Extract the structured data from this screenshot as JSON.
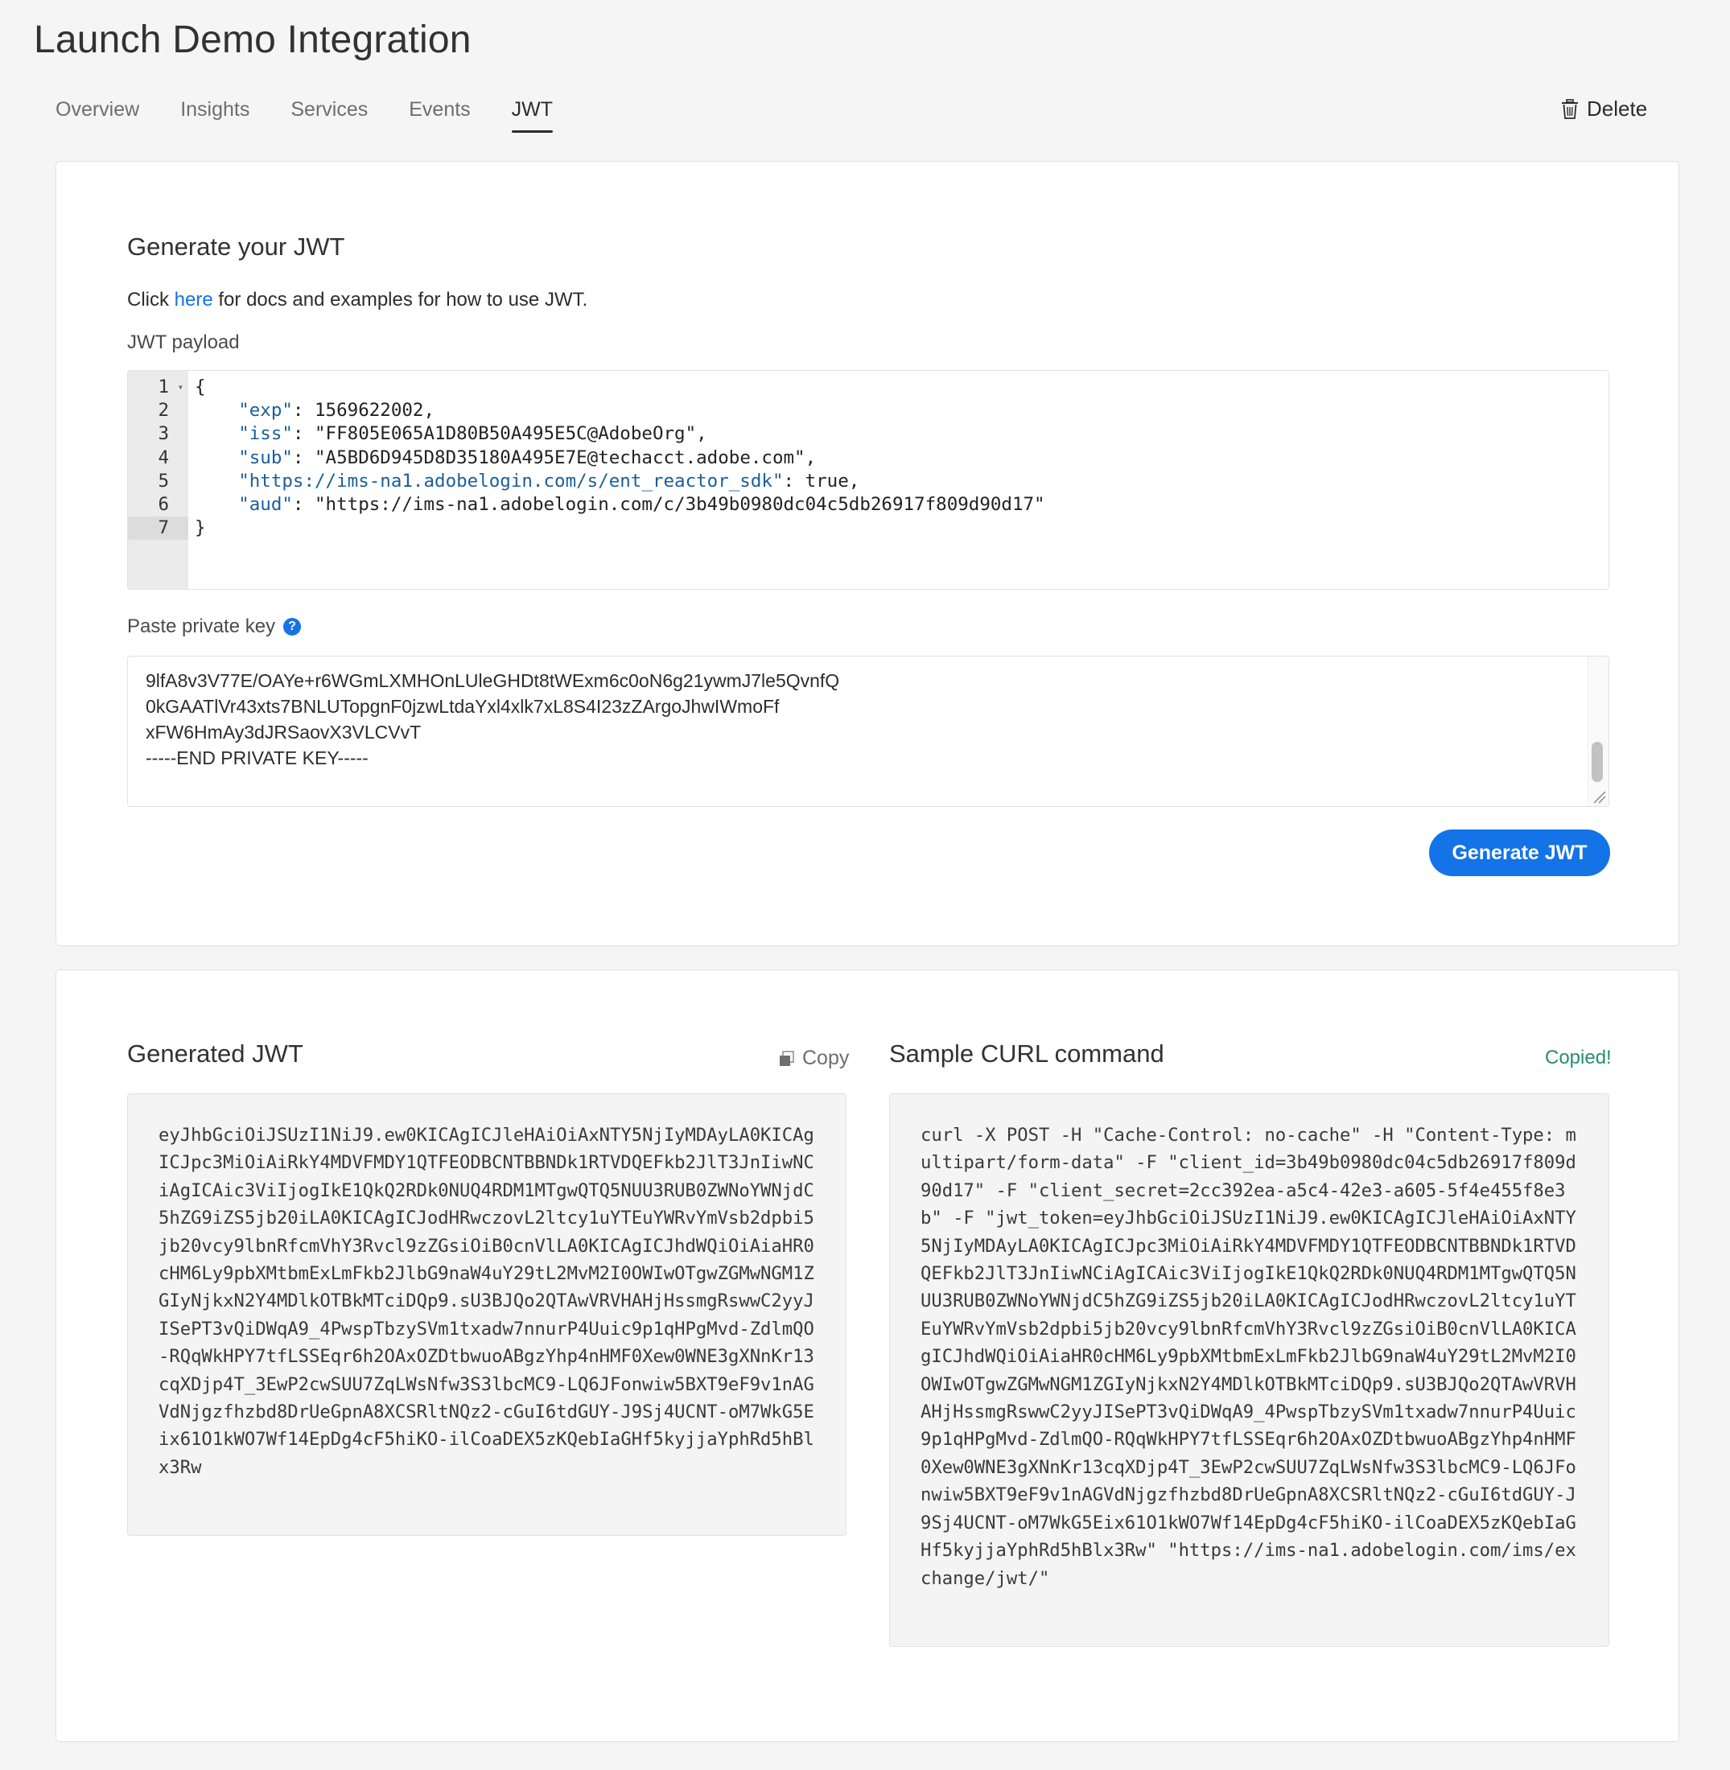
{
  "page": {
    "title": "Launch Demo Integration"
  },
  "tabs": [
    {
      "label": "Overview",
      "active": false
    },
    {
      "label": "Insights",
      "active": false
    },
    {
      "label": "Services",
      "active": false
    },
    {
      "label": "Events",
      "active": false
    },
    {
      "label": "JWT",
      "active": true
    }
  ],
  "header": {
    "delete_label": "Delete",
    "delete_icon": "trash-icon"
  },
  "generate_section": {
    "title": "Generate your JWT",
    "help_prefix": "Click ",
    "help_link": "here",
    "help_suffix": " for docs and examples for how to use JWT.",
    "payload_label": "JWT payload",
    "payload_lines": [
      {
        "num": "1",
        "text": "{"
      },
      {
        "num": "2",
        "text": "    \"exp\": 1569622002,"
      },
      {
        "num": "3",
        "text": "    \"iss\": \"FF805E065A1D80B50A495E5C@AdobeOrg\","
      },
      {
        "num": "4",
        "text": "    \"sub\": \"A5BD6D945D8D35180A495E7E@techacct.adobe.com\","
      },
      {
        "num": "5",
        "text": "    \"https://ims-na1.adobelogin.com/s/ent_reactor_sdk\": true,"
      },
      {
        "num": "6",
        "text": "    \"aud\": \"https://ims-na1.adobelogin.com/c/3b49b0980dc04c5db26917f809d90d17\""
      },
      {
        "num": "7",
        "text": "}"
      }
    ],
    "active_line": "7",
    "private_key_label": "Paste private key",
    "private_key_lines": [
      "9lfA8v3V77E/OAYe+r6WGmLXMHOnLUleGHDt8tWExm6c0oN6g21ywmJ7le5QvnfQ",
      "0kGAATlVr43xts7BNLUTopgnF0jzwLtdaYxl4xlk7xL8S4I23zZArgoJhwIWmoFf",
      "xFW6HmAy3dJRSaovX3VLCVvT",
      "-----END PRIVATE KEY-----"
    ],
    "generate_button_label": "Generate JWT"
  },
  "output_section": {
    "jwt_title": "Generated JWT",
    "copy_label": "Copy",
    "generated_jwt": "eyJhbGciOiJSUzI1NiJ9.ew0KICAgICJleHAiOiAxNTY5NjIyMDAyLA0KICAgICJpc3MiOiAiRkY4MDVFMDY1QTFEODBCNTBBNDk1RTVDQEFkb2JlT3JnIiwNCiAgICAic3ViIjogIkE1QkQ2RDk0NUQ4RDM1MTgwQTQ5NUU3RUB0ZWNoYWNjdC5hZG9iZS5jb20iLA0KICAgICJodHRwczovL2ltcy1uYTEuYWRvYmVsb2dpbi5jb20vcy9lbnRfcmVhY3Rvcl9zZGsiOiB0cnVlLA0KICAgICJhdWQiOiAiaHR0cHM6Ly9pbXMtbmExLmFkb2JlbG9naW4uY29tL2MvM2I0OWIwOTgwZGMwNGM1ZGIyNjkxN2Y4MDlkOTBkMTciDQp9.sU3BJQo2QTAwVRVHAHjHssmgRswwC2yyJISePT3vQiDWqA9_4PwspTbzySVm1txadw7nnurP4Uuic9p1qHPgMvd-ZdlmQO-RQqWkHPY7tfLSSEqr6h2OAxOZDtbwuoABgzYhp4nHMF0Xew0WNE3gXNnKr13cqXDjp4T_3EwP2cwSUU7ZqLWsNfw3S3lbcMC9-LQ6JFonwiw5BXT9eF9v1nAGVdNjgzfhzbd8DrUeGpnA8XCSRltNQz2-cGuI6tdGUY-J9Sj4UCNT-oM7WkG5Eix61O1kWO7Wf14EpDg4cF5hiKO-ilCoaDEX5zKQebIaGHf5kyjjaYphRd5hBlx3Rw",
    "curl_title": "Sample CURL command",
    "copied_status": "Copied!",
    "curl_command": "curl -X POST -H \"Cache-Control: no-cache\" -H \"Content-Type: multipart/form-data\" -F \"client_id=3b49b0980dc04c5db26917f809d90d17\" -F \"client_secret=2cc392ea-a5c4-42e3-a605-5f4e455f8e3b\" -F \"jwt_token=eyJhbGciOiJSUzI1NiJ9.ew0KICAgICJleHAiOiAxNTY5NjIyMDAyLA0KICAgICJpc3MiOiAiRkY4MDVFMDY1QTFEODBCNTBBNDk1RTVDQEFkb2JlT3JnIiwNCiAgICAic3ViIjogIkE1QkQ2RDk0NUQ4RDM1MTgwQTQ5NUU3RUB0ZWNoYWNjdC5hZG9iZS5jb20iLA0KICAgICJodHRwczovL2ltcy1uYTEuYWRvYmVsb2dpbi5jb20vcy9lbnRfcmVhY3Rvcl9zZGsiOiB0cnVlLA0KICAgICJhdWQiOiAiaHR0cHM6Ly9pbXMtbmExLmFkb2JlbG9naW4uY29tL2MvM2I0OWIwOTgwZGMwNGM1ZGIyNjkxN2Y4MDlkOTBkMTciDQp9.sU3BJQo2QTAwVRVHAHjHssmgRswwC2yyJISePT3vQiDWqA9_4PwspTbzySVm1txadw7nnurP4Uuic9p1qHPgMvd-ZdlmQO-RQqWkHPY7tfLSSEqr6h2OAxOZDtbwuoABgzYhp4nHMF0Xew0WNE3gXNnKr13cqXDjp4T_3EwP2cwSUU7ZqLWsNfw3S3lbcMC9-LQ6JFonwiw5BXT9eF9v1nAGVdNjgzfhzbd8DrUeGpnA8XCSRltNQz2-cGuI6tdGUY-J9Sj4UCNT-oM7WkG5Eix61O1kWO7Wf14EpDg4cF5hiKO-ilCoaDEX5zKQebIaGHf5kyjjaYphRd5hBlx3Rw\" \"https://ims-na1.adobelogin.com/ims/exchange/jwt/\""
  },
  "colors": {
    "accent": "#1473e6",
    "success": "#268e6c",
    "background": "#f5f5f5"
  }
}
